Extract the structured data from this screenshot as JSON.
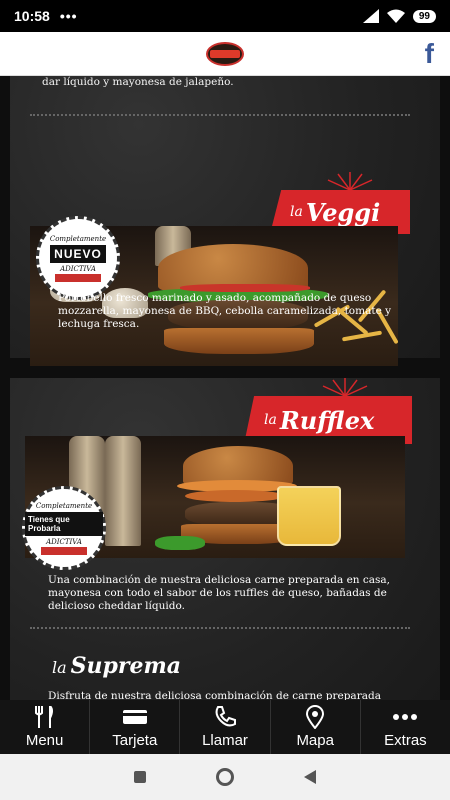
{
  "status_bar": {
    "time": "10:58",
    "dots": "•••",
    "battery": "99"
  },
  "header": {
    "logo_icon": "restaurant-logo-icon",
    "facebook_label": "f"
  },
  "items": [
    {
      "intro_text": "dar líquido y mayonesa de jalapeño.",
      "title_prefix": "la",
      "title": "Veggi",
      "badge_top": "Completamente",
      "badge_main": "NUEVO",
      "badge_bottom": "ADICTIVA",
      "description": "Portobello fresco marinado y asado, acompañado de queso mozzarella, mayonesa de BBQ, cebolla caramelizada, tomate y lechuga fresca."
    },
    {
      "title_prefix": "la",
      "title": "Rufflex",
      "badge_top": "Completamente",
      "badge_main": "Tienes que Probarla",
      "badge_bottom": "ADICTIVA",
      "description": "Una combinación de nuestra deliciosa carne preparada en casa, mayonesa con todo el sabor de los ruffles de queso, bañadas de delicioso cheddar líquido."
    },
    {
      "title_prefix": "la",
      "title": "Suprema",
      "description": "Disfruta de nuestra deliciosa combinación de carne preparada"
    }
  ],
  "nav": [
    {
      "label": "Menu",
      "icon": "fork-knife-icon"
    },
    {
      "label": "Tarjeta",
      "icon": "card-icon"
    },
    {
      "label": "Llamar",
      "icon": "phone-icon"
    },
    {
      "label": "Mapa",
      "icon": "map-pin-icon"
    },
    {
      "label": "Extras",
      "icon": "more-dots-icon"
    }
  ],
  "colors": {
    "accent": "#d7262a",
    "facebook": "#3b5998",
    "nav_bg": "#141414"
  }
}
